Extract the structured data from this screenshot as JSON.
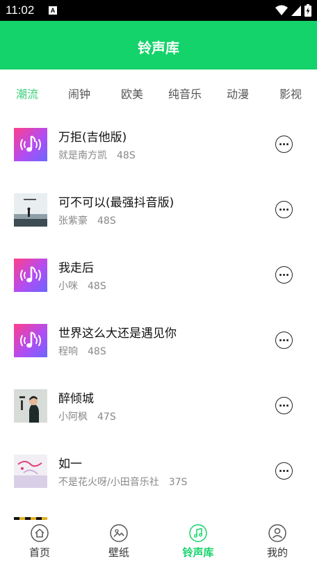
{
  "status": {
    "time": "11:02",
    "notification_icon": "A"
  },
  "header": {
    "title": "铃声库"
  },
  "tabs": [
    {
      "label": "潮流",
      "active": true
    },
    {
      "label": "闹钟",
      "active": false
    },
    {
      "label": "欧美",
      "active": false
    },
    {
      "label": "纯音乐",
      "active": false
    },
    {
      "label": "动漫",
      "active": false
    },
    {
      "label": "影视",
      "active": false
    }
  ],
  "songs": [
    {
      "title": "万拒(吉他版)",
      "artist": "就是南方凯",
      "duration": "48S",
      "cover": "music-note-icon"
    },
    {
      "title": "可不可以(最强抖音版)",
      "artist": "张紫豪",
      "duration": "48S",
      "cover": "album-cover-beach"
    },
    {
      "title": "我走后",
      "artist": "小咪",
      "duration": "48S",
      "cover": "music-note-icon"
    },
    {
      "title": "世界这么大还是遇见你",
      "artist": "程响",
      "duration": "48S",
      "cover": "music-note-icon"
    },
    {
      "title": "醉倾城",
      "artist": "小阿枫",
      "duration": "47S",
      "cover": "album-cover-portrait"
    },
    {
      "title": "如一",
      "artist": "不是花火呀/小田音乐社",
      "duration": "37S",
      "cover": "album-cover-pink"
    }
  ],
  "bottom_nav": [
    {
      "label": "首页",
      "icon": "home-icon",
      "active": false
    },
    {
      "label": "壁纸",
      "icon": "image-icon",
      "active": false
    },
    {
      "label": "铃声库",
      "icon": "music-icon",
      "active": true
    },
    {
      "label": "我的",
      "icon": "profile-icon",
      "active": false
    }
  ],
  "colors": {
    "primary": "#14d36a",
    "tab_active": "#3ccf7b",
    "text_secondary": "#888888"
  }
}
